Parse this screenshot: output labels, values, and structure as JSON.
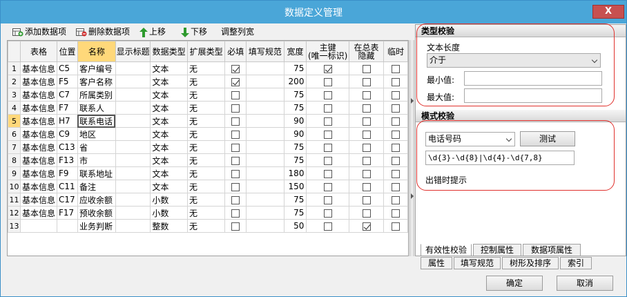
{
  "window": {
    "title": "数据定义管理",
    "close_label": "X"
  },
  "toolbar": {
    "add_label": "添加数据项",
    "delete_label": "删除数据项",
    "up_label": "上移",
    "down_label": "下移",
    "adjust_label": "调整列宽"
  },
  "table": {
    "headers": {
      "table_name": "表格",
      "position": "位置",
      "name": "名称",
      "display_title": "显示标题",
      "data_type": "数据类型",
      "ext_type": "扩展类型",
      "required": "必填",
      "fill_rule": "填写规范",
      "width": "宽度",
      "pk_line1": "主键",
      "pk_line2": "(唯一标识)",
      "hide_line1": "在总表",
      "hide_line2": "隐藏",
      "temp": "临时"
    },
    "rows": [
      {
        "n": "1",
        "table": "基本信息",
        "pos": "C5",
        "name": "客户编号",
        "title": "",
        "dtype": "文本",
        "ext": "无",
        "req": true,
        "rule": "",
        "width": "75",
        "pk": true,
        "hide": false,
        "temp": false
      },
      {
        "n": "2",
        "table": "基本信息",
        "pos": "F5",
        "name": "客户名称",
        "title": "",
        "dtype": "文本",
        "ext": "无",
        "req": true,
        "rule": "",
        "width": "200",
        "pk": false,
        "hide": false,
        "temp": false
      },
      {
        "n": "3",
        "table": "基本信息",
        "pos": "C7",
        "name": "所属类别",
        "title": "",
        "dtype": "文本",
        "ext": "无",
        "req": false,
        "rule": "",
        "width": "75",
        "pk": false,
        "hide": false,
        "temp": false
      },
      {
        "n": "4",
        "table": "基本信息",
        "pos": "F7",
        "name": "联系人",
        "title": "",
        "dtype": "文本",
        "ext": "无",
        "req": false,
        "rule": "",
        "width": "75",
        "pk": false,
        "hide": false,
        "temp": false
      },
      {
        "n": "5",
        "table": "基本信息",
        "pos": "H7",
        "name": "联系电话",
        "title": "",
        "dtype": "文本",
        "ext": "无",
        "req": false,
        "rule": "",
        "width": "90",
        "pk": false,
        "hide": false,
        "temp": false
      },
      {
        "n": "6",
        "table": "基本信息",
        "pos": "C9",
        "name": "地区",
        "title": "",
        "dtype": "文本",
        "ext": "无",
        "req": false,
        "rule": "",
        "width": "90",
        "pk": false,
        "hide": false,
        "temp": false
      },
      {
        "n": "7",
        "table": "基本信息",
        "pos": "C13",
        "name": "省",
        "title": "",
        "dtype": "文本",
        "ext": "无",
        "req": false,
        "rule": "",
        "width": "75",
        "pk": false,
        "hide": false,
        "temp": false
      },
      {
        "n": "8",
        "table": "基本信息",
        "pos": "F13",
        "name": "市",
        "title": "",
        "dtype": "文本",
        "ext": "无",
        "req": false,
        "rule": "",
        "width": "75",
        "pk": false,
        "hide": false,
        "temp": false
      },
      {
        "n": "9",
        "table": "基本信息",
        "pos": "F9",
        "name": "联系地址",
        "title": "",
        "dtype": "文本",
        "ext": "无",
        "req": false,
        "rule": "",
        "width": "180",
        "pk": false,
        "hide": false,
        "temp": false
      },
      {
        "n": "10",
        "table": "基本信息",
        "pos": "C11",
        "name": "备注",
        "title": "",
        "dtype": "文本",
        "ext": "无",
        "req": false,
        "rule": "",
        "width": "150",
        "pk": false,
        "hide": false,
        "temp": false
      },
      {
        "n": "11",
        "table": "基本信息",
        "pos": "C17",
        "name": "应收余额",
        "title": "",
        "dtype": "小数",
        "ext": "无",
        "req": false,
        "rule": "",
        "width": "75",
        "pk": false,
        "hide": false,
        "temp": false
      },
      {
        "n": "12",
        "table": "基本信息",
        "pos": "F17",
        "name": "预收余额",
        "title": "",
        "dtype": "小数",
        "ext": "无",
        "req": false,
        "rule": "",
        "width": "75",
        "pk": false,
        "hide": false,
        "temp": false
      },
      {
        "n": "13",
        "table": "",
        "pos": "",
        "name": "业务判断",
        "title": "",
        "dtype": "整数",
        "ext": "无",
        "req": false,
        "rule": "",
        "width": "50",
        "pk": false,
        "hide": true,
        "temp": false
      }
    ]
  },
  "type_check": {
    "header": "类型校验",
    "length_label": "文本长度",
    "length_value": "介于",
    "min_label": "最小值:",
    "min_value": "",
    "max_label": "最大值:",
    "max_value": ""
  },
  "pattern_check": {
    "header": "模式校验",
    "pattern_value": "电话号码",
    "test_label": "测试",
    "regex_value": "\\d{3}-\\d{8}|\\d{4}-\\d{7,8}",
    "error_label": "出错时提示"
  },
  "tabs_row1": [
    "有效性校验",
    "控制属性",
    "数据项属性"
  ],
  "tabs_row2": [
    "属性",
    "填写规范",
    "树形及排序",
    "索引"
  ],
  "footer": {
    "ok_label": "确定",
    "cancel_label": "取消"
  },
  "colors": {
    "titlebar": "#4aa6d8",
    "close": "#c75050",
    "highlight": "#ffd87a",
    "ring": "#e0302c"
  }
}
